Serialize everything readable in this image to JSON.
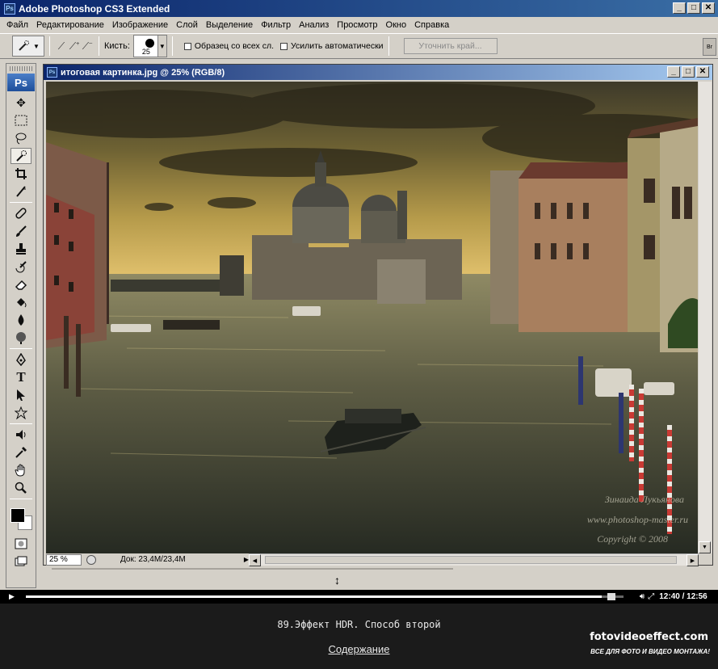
{
  "app": {
    "title": "Adobe Photoshop CS3 Extended",
    "icon_text": "Ps"
  },
  "window_buttons": [
    "_",
    "□",
    "✕"
  ],
  "menu": [
    "Файл",
    "Редактирование",
    "Изображение",
    "Слой",
    "Выделение",
    "Фильтр",
    "Анализ",
    "Просмотр",
    "Окно",
    "Справка"
  ],
  "options": {
    "brush_label": "Кисть:",
    "brush_size": "25",
    "sample_all": "Образец со всех сл.",
    "auto_enhance": "Усилить автоматически",
    "refine_edge": "Уточнить край..."
  },
  "toolbox": {
    "logo": "Ps"
  },
  "document": {
    "title": "итоговая картинка.jpg @ 25% (RGB/8)",
    "zoom": "25 %",
    "doc_info": "Док: 23,4M/23,4M",
    "watermark": [
      "Зинаида Лукьянова",
      "www.photoshop-master.ru",
      "Copyright © 2008"
    ]
  },
  "player": {
    "time": "12:40 / 12:56",
    "progress": 0.9836
  },
  "lesson": {
    "title": "89.Эффект HDR. Способ второй",
    "contents_link": "Содержание"
  },
  "brand": {
    "name": "fotovideoeffect.com",
    "tagline": "ВСЕ ДЛЯ ФОТО И ВИДЕО МОНТАЖА!"
  }
}
